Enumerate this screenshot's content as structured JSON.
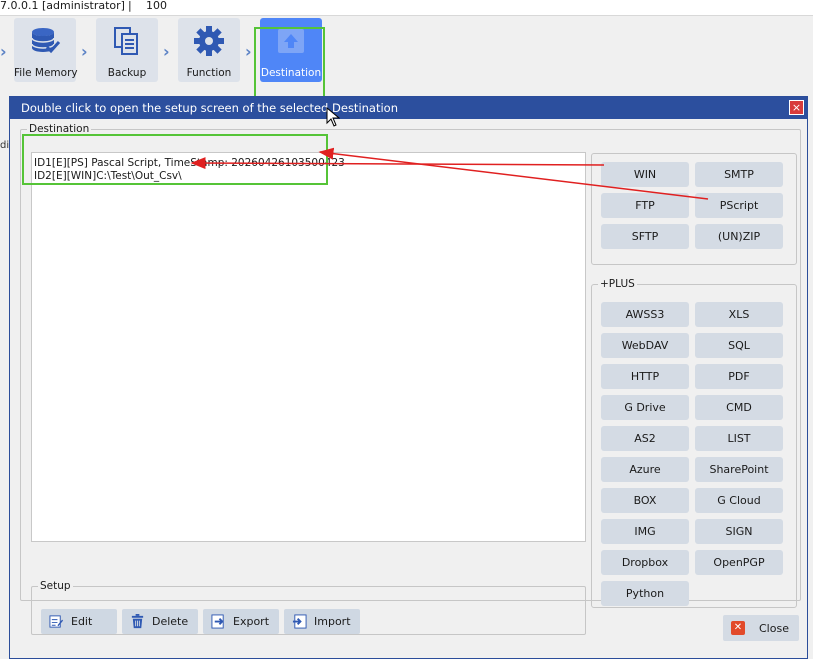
{
  "topbar": {
    "version": "7.0.0.1 [administrator]",
    "sep": "|",
    "count": "100"
  },
  "toolbar": {
    "tools": [
      {
        "label": "File Memory",
        "icon": "database-check-icon"
      },
      {
        "label": "Backup",
        "icon": "documents-icon"
      },
      {
        "label": "Function",
        "icon": "gear-icon"
      },
      {
        "label": "Destination",
        "icon": "upload-icon",
        "active": true
      }
    ]
  },
  "left_stub": "di",
  "dialog": {
    "title": "Double click to open the setup screen of the selected Destination",
    "close_glyph": "×",
    "destination_legend": "Destination",
    "destinations": [
      "ID1[E][PS] Pascal Script, TimeStamp: 20260426103500423",
      "ID2[E][WIN]C:\\Test\\Out_Csv\\"
    ],
    "setup_legend": "Setup",
    "setup_buttons": [
      {
        "label": "Edit",
        "icon": "edit-icon"
      },
      {
        "label": "Delete",
        "icon": "trash-icon"
      },
      {
        "label": "Export",
        "icon": "export-icon"
      },
      {
        "label": "Import",
        "icon": "import-icon"
      }
    ],
    "basic_buttons": [
      "WIN",
      "SMTP",
      "FTP",
      "PScript",
      "SFTP",
      "(UN)ZIP"
    ],
    "plus_legend": "+PLUS",
    "plus_buttons": [
      "AWSS3",
      "XLS",
      "WebDAV",
      "SQL",
      "HTTP",
      "PDF",
      "G Drive",
      "CMD",
      "AS2",
      "LIST",
      "Azure",
      "SharePoint",
      "BOX",
      "G Cloud",
      "IMG",
      "SIGN",
      "Dropbox",
      "OpenPGP",
      "Python"
    ],
    "close_button": "Close"
  },
  "colors": {
    "title_bar": "#2c4f9e",
    "active_tool": "#4f86f7",
    "highlight_green": "#55c437",
    "arrow_red": "#e02020",
    "button_bg": "#d4dbe4"
  }
}
